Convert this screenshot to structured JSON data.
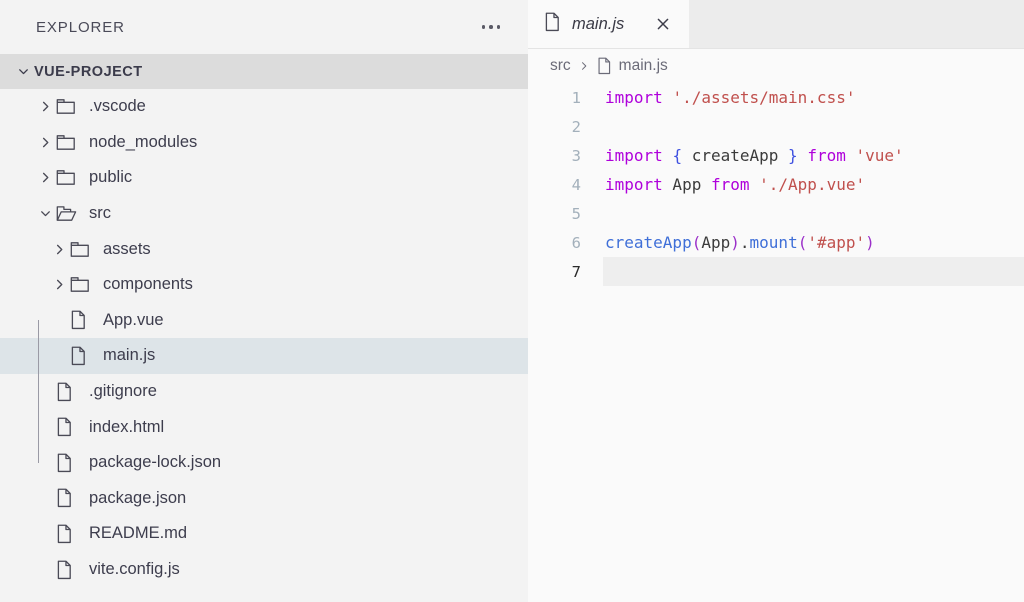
{
  "sidebar": {
    "title": "EXPLORER",
    "more_actions_icon": "ellipsis-icon",
    "section": {
      "label": "VUE-PROJECT",
      "expanded": true,
      "chevron_icon": "chevron-down-icon"
    },
    "items": [
      {
        "label": ".vscode",
        "type": "folder",
        "icon": "folder-closed-icon",
        "expanded": false,
        "depth": 1,
        "selected": false
      },
      {
        "label": "node_modules",
        "type": "folder",
        "icon": "folder-closed-icon",
        "expanded": false,
        "depth": 1,
        "selected": false
      },
      {
        "label": "public",
        "type": "folder",
        "icon": "folder-closed-icon",
        "expanded": false,
        "depth": 1,
        "selected": false
      },
      {
        "label": "src",
        "type": "folder",
        "icon": "folder-open-icon",
        "expanded": true,
        "depth": 1,
        "selected": false
      },
      {
        "label": "assets",
        "type": "folder",
        "icon": "folder-closed-icon",
        "expanded": false,
        "depth": 2,
        "selected": false
      },
      {
        "label": "components",
        "type": "folder",
        "icon": "folder-closed-icon",
        "expanded": false,
        "depth": 2,
        "selected": false
      },
      {
        "label": "App.vue",
        "type": "file",
        "icon": "file-icon",
        "expanded": false,
        "depth": 2,
        "selected": false
      },
      {
        "label": "main.js",
        "type": "file",
        "icon": "file-icon",
        "expanded": false,
        "depth": 2,
        "selected": true
      },
      {
        "label": ".gitignore",
        "type": "file",
        "icon": "file-icon",
        "expanded": false,
        "depth": 1,
        "selected": false
      },
      {
        "label": "index.html",
        "type": "file",
        "icon": "file-icon",
        "expanded": false,
        "depth": 1,
        "selected": false
      },
      {
        "label": "package-lock.json",
        "type": "file",
        "icon": "file-icon",
        "expanded": false,
        "depth": 1,
        "selected": false
      },
      {
        "label": "package.json",
        "type": "file",
        "icon": "file-icon",
        "expanded": false,
        "depth": 1,
        "selected": false
      },
      {
        "label": "README.md",
        "type": "file",
        "icon": "file-icon",
        "expanded": false,
        "depth": 1,
        "selected": false
      },
      {
        "label": "vite.config.js",
        "type": "file",
        "icon": "file-icon",
        "expanded": false,
        "depth": 1,
        "selected": false
      }
    ]
  },
  "editor": {
    "tabs": [
      {
        "label": "main.js",
        "icon": "file-icon",
        "active": true,
        "preview": true,
        "close_icon": "close-icon"
      }
    ],
    "breadcrumbs": [
      {
        "label": "src",
        "icon": null
      },
      {
        "label": "main.js",
        "icon": "file-icon"
      }
    ],
    "breadcrumb_separator_icon": "chevron-right-icon",
    "current_line": 7,
    "lines": [
      {
        "number": "1",
        "tokens": [
          {
            "t": "import",
            "c": "tok-kw"
          },
          {
            "t": " ",
            "c": "tok-id"
          },
          {
            "t": "'./assets/main.css'",
            "c": "tok-str"
          }
        ]
      },
      {
        "number": "2",
        "tokens": []
      },
      {
        "number": "3",
        "tokens": [
          {
            "t": "import",
            "c": "tok-kw"
          },
          {
            "t": " ",
            "c": "tok-id"
          },
          {
            "t": "{",
            "c": "tok-br"
          },
          {
            "t": " createApp ",
            "c": "tok-id"
          },
          {
            "t": "}",
            "c": "tok-br"
          },
          {
            "t": " ",
            "c": "tok-id"
          },
          {
            "t": "from",
            "c": "tok-kw"
          },
          {
            "t": " ",
            "c": "tok-id"
          },
          {
            "t": "'vue'",
            "c": "tok-str"
          }
        ]
      },
      {
        "number": "4",
        "tokens": [
          {
            "t": "import",
            "c": "tok-kw"
          },
          {
            "t": " App ",
            "c": "tok-id"
          },
          {
            "t": "from",
            "c": "tok-kw"
          },
          {
            "t": " ",
            "c": "tok-id"
          },
          {
            "t": "'./App.vue'",
            "c": "tok-str"
          }
        ]
      },
      {
        "number": "5",
        "tokens": []
      },
      {
        "number": "6",
        "tokens": [
          {
            "t": "createApp",
            "c": "tok-fn"
          },
          {
            "t": "(",
            "c": "tok-punc"
          },
          {
            "t": "App",
            "c": "tok-id"
          },
          {
            "t": ")",
            "c": "tok-punc"
          },
          {
            "t": ".",
            "c": "tok-dot"
          },
          {
            "t": "mount",
            "c": "tok-fn"
          },
          {
            "t": "(",
            "c": "tok-punc"
          },
          {
            "t": "'#app'",
            "c": "tok-str"
          },
          {
            "t": ")",
            "c": "tok-punc"
          }
        ]
      },
      {
        "number": "7",
        "tokens": []
      }
    ]
  },
  "colors": {
    "sidebar_bg": "#f3f3f3",
    "editor_bg": "#fafafa",
    "tabbar_bg": "#ececec",
    "selection_bg": "#dde4e8",
    "section_header_bg": "#dcdcdc",
    "current_line_bg": "#eeeeee",
    "keyword": "#af00db",
    "string": "#c0504d",
    "function": "#3f6fd8",
    "bracket": "#3f51e0",
    "identifier": "#3b3b3b"
  }
}
